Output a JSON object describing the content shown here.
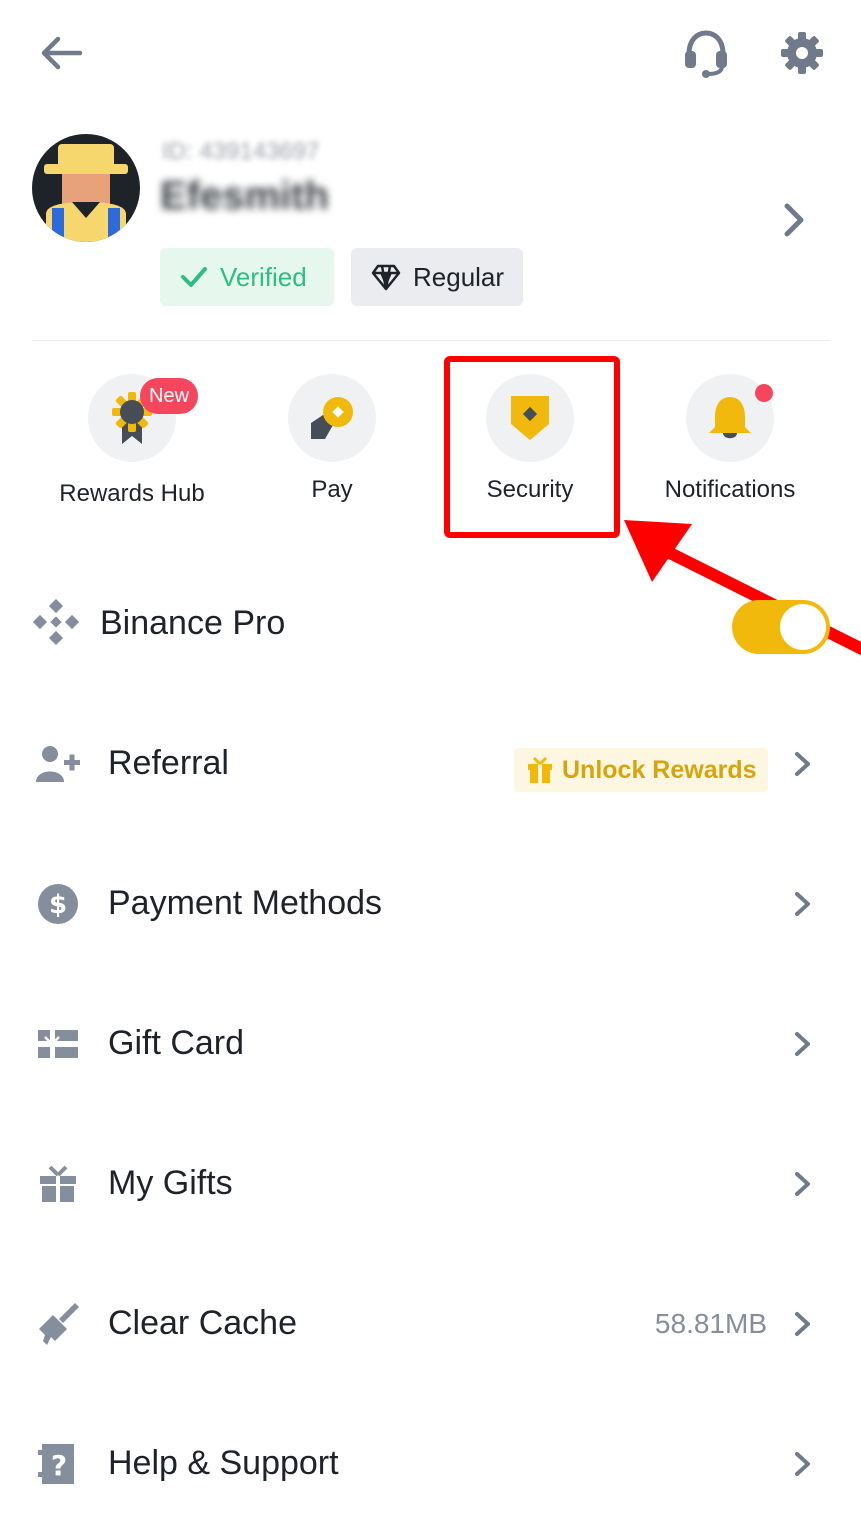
{
  "header": {
    "back_icon": "arrow-left-icon",
    "support_icon": "headset-icon",
    "settings_icon": "gear-icon"
  },
  "profile": {
    "uid": "ID: 439143697",
    "username": "Efesmith",
    "verified_label": "Verified",
    "tier_label": "Regular"
  },
  "shortcuts": [
    {
      "label": "Rewards Hub",
      "icon": "ribbon-medal-icon",
      "badge": "New"
    },
    {
      "label": "Pay",
      "icon": "pay-icon"
    },
    {
      "label": "Security",
      "icon": "shield-icon"
    },
    {
      "label": "Notifications",
      "icon": "bell-icon"
    }
  ],
  "menu": {
    "binance_pro": {
      "label": "Binance Pro",
      "toggle_on": true
    },
    "referral": {
      "label": "Referral",
      "chip": "Unlock Rewards"
    },
    "payment_methods": {
      "label": "Payment Methods"
    },
    "gift_card": {
      "label": "Gift Card"
    },
    "my_gifts": {
      "label": "My Gifts"
    },
    "clear_cache": {
      "label": "Clear Cache",
      "value": "58.81MB"
    },
    "help_support": {
      "label": "Help & Support"
    }
  },
  "colors": {
    "accent": "#f0b90b",
    "verified": "#2ebd85",
    "alert": "#f6465d",
    "annotation": "#ff0000",
    "icon_gray": "#848e9c"
  }
}
